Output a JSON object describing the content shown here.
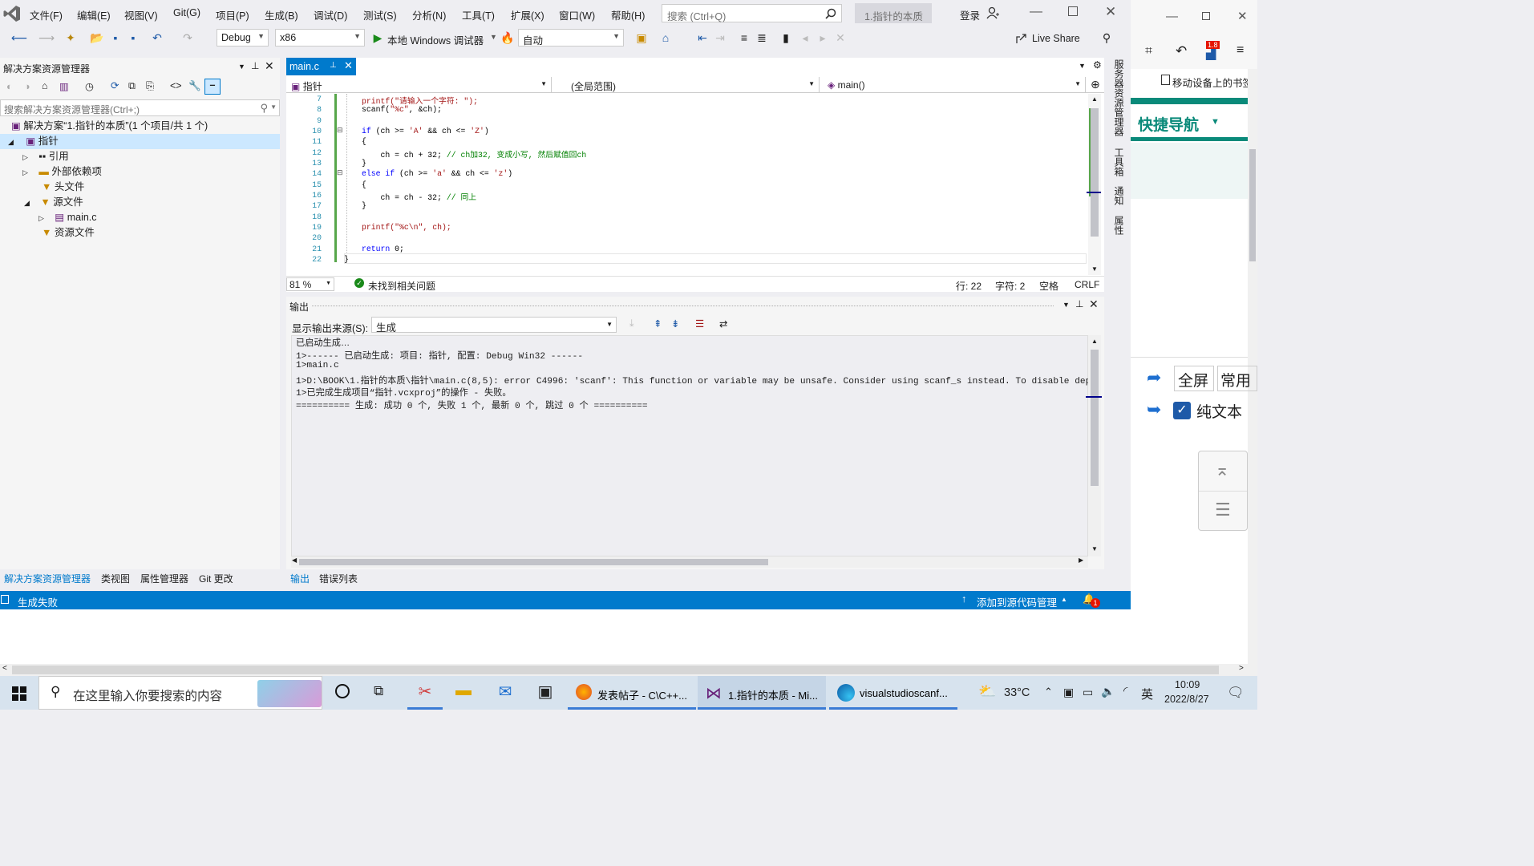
{
  "menu": {
    "items": [
      "文件(F)",
      "编辑(E)",
      "视图(V)",
      "Git(G)",
      "项目(P)",
      "生成(B)",
      "调试(D)",
      "测试(S)",
      "分析(N)",
      "工具(T)",
      "扩展(X)",
      "窗口(W)",
      "帮助(H)"
    ],
    "search_placeholder": "搜索 (Ctrl+Q)",
    "window_title": "1.指针的本质",
    "login": "登录"
  },
  "toolbar": {
    "config": "Debug",
    "platform": "x86",
    "run_label": "本地 Windows 调试器",
    "auto": "自动",
    "live_share": "Live Share"
  },
  "solution_explorer": {
    "title": "解决方案资源管理器",
    "search_placeholder": "搜索解决方案资源管理器(Ctrl+;)",
    "items": [
      {
        "label": "解决方案“1.指针的本质”(1 个项目/共 1 个)"
      },
      {
        "label": "指针"
      },
      {
        "label": "引用"
      },
      {
        "label": "外部依赖项"
      },
      {
        "label": "头文件"
      },
      {
        "label": "源文件"
      },
      {
        "label": "main.c"
      },
      {
        "label": "资源文件"
      }
    ],
    "bottom_tabs": [
      "解决方案资源管理器",
      "类视图",
      "属性管理器",
      "Git 更改"
    ]
  },
  "editor": {
    "tab": "main.c",
    "nav_project": "指针",
    "nav_scope": "(全局范围)",
    "nav_func": "main()",
    "lines": [
      {
        "n": "7",
        "code": "printf(\"请输入一个字符: \");"
      },
      {
        "n": "8",
        "code": "scanf(\"%c\", &ch);"
      },
      {
        "n": "9",
        "code": ""
      },
      {
        "n": "10",
        "code": "if (ch >= 'A' && ch <= 'Z')"
      },
      {
        "n": "11",
        "code": "{"
      },
      {
        "n": "12",
        "code": "    ch = ch + 32; // ch加32, 变成小写, 然后赋值回ch"
      },
      {
        "n": "13",
        "code": "}"
      },
      {
        "n": "14",
        "code": "else if (ch >= 'a' && ch <= 'z')"
      },
      {
        "n": "15",
        "code": "{"
      },
      {
        "n": "16",
        "code": "    ch = ch - 32; // 同上"
      },
      {
        "n": "17",
        "code": "}"
      },
      {
        "n": "18",
        "code": ""
      },
      {
        "n": "19",
        "code": "printf(\"%c\\n\", ch);"
      },
      {
        "n": "20",
        "code": ""
      },
      {
        "n": "21",
        "code": "return 0;"
      },
      {
        "n": "22",
        "code": "}"
      }
    ],
    "zoom": "81 %",
    "issues": "未找到相关问题",
    "row": "行: 22",
    "col": "字符: 2",
    "spaces": "空格",
    "eol": "CRLF"
  },
  "output": {
    "title": "输出",
    "source_label": "显示输出来源(S):",
    "source": "生成",
    "lines": [
      "已启动生成…",
      "1>------ 已启动生成: 项目: 指针, 配置: Debug Win32 ------",
      "1>main.c",
      "1>D:\\BOOK\\1.指针的本质\\指针\\main.c(8,5): error C4996: 'scanf': This function or variable may be unsafe. Consider using scanf_s instead. To disable depr",
      "1>已完成生成项目“指针.vcxproj”的操作 - 失败。",
      "========== 生成: 成功 0 个, 失败 1 个, 最新 0 个, 跳过 0 个 =========="
    ],
    "tabs": [
      "输出",
      "错误列表"
    ]
  },
  "side_tabs": [
    "服务器资源管理器",
    "工具箱",
    "通知",
    "属性"
  ],
  "status": {
    "left": "生成失败",
    "source_control": "添加到源代码管理",
    "badge": "1"
  },
  "browser": {
    "version_badge": "1.8",
    "bookmarks": "移动设备上的书签",
    "quick_nav": "快捷导航",
    "fullscreen": "全屏",
    "common": "常用",
    "plain_text": "纯文本"
  },
  "taskbar": {
    "search_placeholder": "在这里输入你要搜索的内容",
    "apps": [
      {
        "label": "发表帖子 - C\\C++..."
      },
      {
        "label": "1.指针的本质 - Mi..."
      },
      {
        "label": "visualstudioscanf..."
      }
    ],
    "temperature": "33°C",
    "ime": "英",
    "time": "10:09",
    "date": "2022/8/27"
  },
  "colors": {
    "accent": "#007acc",
    "selection": "#cce8ff",
    "taskbar": "#d7e3ee",
    "browser_teal": "#0a8a7a"
  }
}
